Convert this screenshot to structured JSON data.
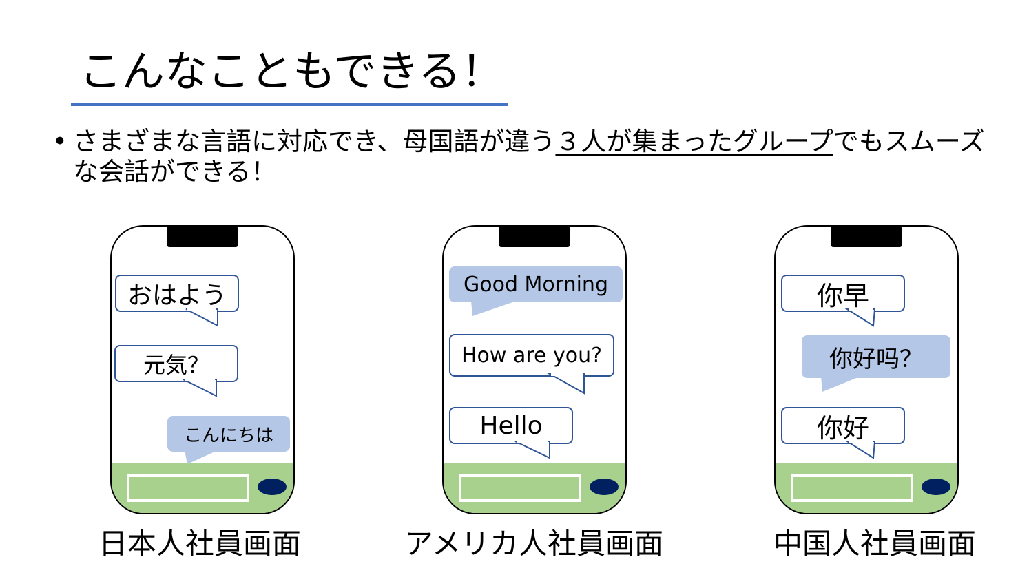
{
  "slide": {
    "title": "こんなこともできる！",
    "bullet": {
      "text_before": "さまざまな言語に対応でき、母国語が違う",
      "underlined": "３人が集まったグループ",
      "text_after": "でもスムーズな会話ができる！"
    }
  },
  "phones": [
    {
      "caption": "日本人社員画面",
      "messages": [
        "おはよう",
        "元気？",
        "こんにちは"
      ]
    },
    {
      "caption": "アメリカ人社員画面",
      "messages": [
        "Good Morning",
        "How are you?",
        "Hello"
      ]
    },
    {
      "caption": "中国人社員画面",
      "messages": [
        "你早",
        "你好吗？",
        "你好"
      ]
    }
  ],
  "colors": {
    "title_rule": "#4472c4",
    "bubble_border": "#2f5597",
    "bubble_fill_highlight": "#b4c7e7",
    "input_bar": "#a9d18e",
    "send_button": "#002060"
  }
}
